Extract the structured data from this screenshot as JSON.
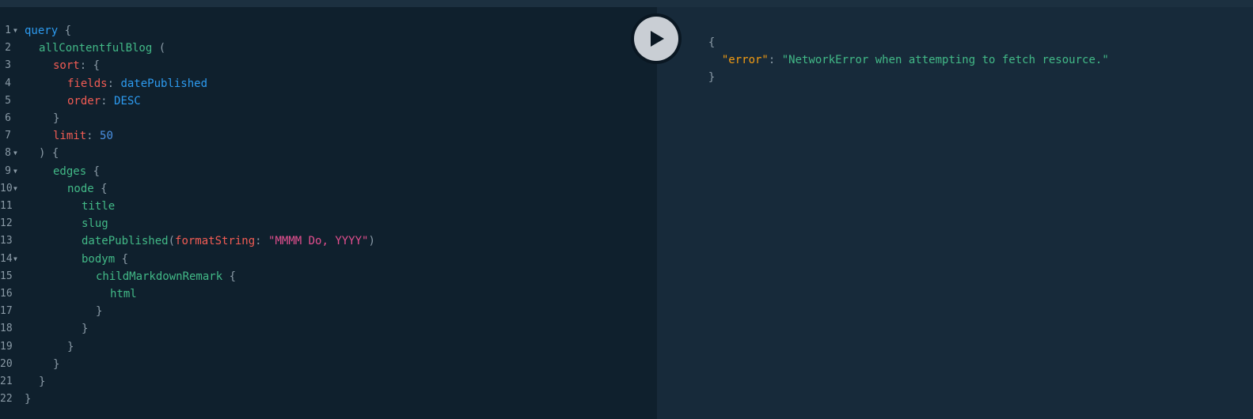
{
  "run_button": {
    "icon": "play-icon"
  },
  "colors": {
    "editor_bg": "#0f202d",
    "result_bg": "#172a3a",
    "keyword": "#2d9bf0",
    "field": "#42b987",
    "argument": "#f25c54",
    "string": "#e34f8f",
    "number": "#4a90e2",
    "punctuation": "#8a9aa6",
    "result_key": "#f39c12"
  },
  "editor": {
    "lines": [
      {
        "n": "1",
        "fold": true,
        "indent": 0,
        "tokens": [
          {
            "t": "kw",
            "v": "query"
          },
          {
            "t": "p",
            "v": " {"
          }
        ]
      },
      {
        "n": "2",
        "fold": false,
        "indent": 1,
        "tokens": [
          {
            "t": "fn",
            "v": "allContentfulBlog"
          },
          {
            "t": "p",
            "v": " ("
          }
        ]
      },
      {
        "n": "3",
        "fold": false,
        "indent": 2,
        "tokens": [
          {
            "t": "arg",
            "v": "sort"
          },
          {
            "t": "p",
            "v": ": {"
          }
        ]
      },
      {
        "n": "4",
        "fold": false,
        "indent": 3,
        "tokens": [
          {
            "t": "arg",
            "v": "fields"
          },
          {
            "t": "p",
            "v": ": "
          },
          {
            "t": "enum",
            "v": "datePublished"
          }
        ]
      },
      {
        "n": "5",
        "fold": false,
        "indent": 3,
        "tokens": [
          {
            "t": "arg",
            "v": "order"
          },
          {
            "t": "p",
            "v": ": "
          },
          {
            "t": "enum",
            "v": "DESC"
          }
        ]
      },
      {
        "n": "6",
        "fold": false,
        "indent": 2,
        "tokens": [
          {
            "t": "p",
            "v": "}"
          }
        ]
      },
      {
        "n": "7",
        "fold": false,
        "indent": 2,
        "tokens": [
          {
            "t": "arg",
            "v": "limit"
          },
          {
            "t": "p",
            "v": ": "
          },
          {
            "t": "num",
            "v": "50"
          }
        ]
      },
      {
        "n": "8",
        "fold": true,
        "indent": 1,
        "tokens": [
          {
            "t": "p",
            "v": ") {"
          }
        ]
      },
      {
        "n": "9",
        "fold": true,
        "indent": 2,
        "tokens": [
          {
            "t": "fn",
            "v": "edges"
          },
          {
            "t": "p",
            "v": " {"
          }
        ]
      },
      {
        "n": "10",
        "fold": true,
        "indent": 3,
        "tokens": [
          {
            "t": "fn",
            "v": "node"
          },
          {
            "t": "p",
            "v": " {"
          }
        ]
      },
      {
        "n": "11",
        "fold": false,
        "indent": 4,
        "tokens": [
          {
            "t": "fn",
            "v": "title"
          }
        ]
      },
      {
        "n": "12",
        "fold": false,
        "indent": 4,
        "tokens": [
          {
            "t": "fn",
            "v": "slug"
          }
        ]
      },
      {
        "n": "13",
        "fold": false,
        "indent": 4,
        "tokens": [
          {
            "t": "fn",
            "v": "datePublished"
          },
          {
            "t": "p",
            "v": "("
          },
          {
            "t": "arg",
            "v": "formatString"
          },
          {
            "t": "p",
            "v": ": "
          },
          {
            "t": "str",
            "v": "\"MMMM Do, YYYY\""
          },
          {
            "t": "p",
            "v": ")"
          }
        ]
      },
      {
        "n": "14",
        "fold": true,
        "indent": 4,
        "tokens": [
          {
            "t": "fn",
            "v": "bodym"
          },
          {
            "t": "p",
            "v": " {"
          }
        ]
      },
      {
        "n": "15",
        "fold": false,
        "indent": 5,
        "tokens": [
          {
            "t": "fn",
            "v": "childMarkdownRemark"
          },
          {
            "t": "p",
            "v": " {"
          }
        ]
      },
      {
        "n": "16",
        "fold": false,
        "indent": 6,
        "tokens": [
          {
            "t": "fn",
            "v": "html"
          }
        ]
      },
      {
        "n": "17",
        "fold": false,
        "indent": 5,
        "tokens": [
          {
            "t": "p",
            "v": "}"
          }
        ]
      },
      {
        "n": "18",
        "fold": false,
        "indent": 4,
        "tokens": [
          {
            "t": "p",
            "v": "}"
          }
        ]
      },
      {
        "n": "19",
        "fold": false,
        "indent": 3,
        "tokens": [
          {
            "t": "p",
            "v": "}"
          }
        ]
      },
      {
        "n": "20",
        "fold": false,
        "indent": 2,
        "tokens": [
          {
            "t": "p",
            "v": "}"
          }
        ]
      },
      {
        "n": "21",
        "fold": false,
        "indent": 1,
        "tokens": [
          {
            "t": "p",
            "v": "}"
          }
        ]
      },
      {
        "n": "22",
        "fold": false,
        "indent": 0,
        "tokens": [
          {
            "t": "p",
            "v": "}"
          }
        ]
      }
    ]
  },
  "result": {
    "open": "{",
    "key": "\"error\"",
    "colon": ": ",
    "value": "\"NetworkError when attempting to fetch resource.\"",
    "close": "}"
  }
}
